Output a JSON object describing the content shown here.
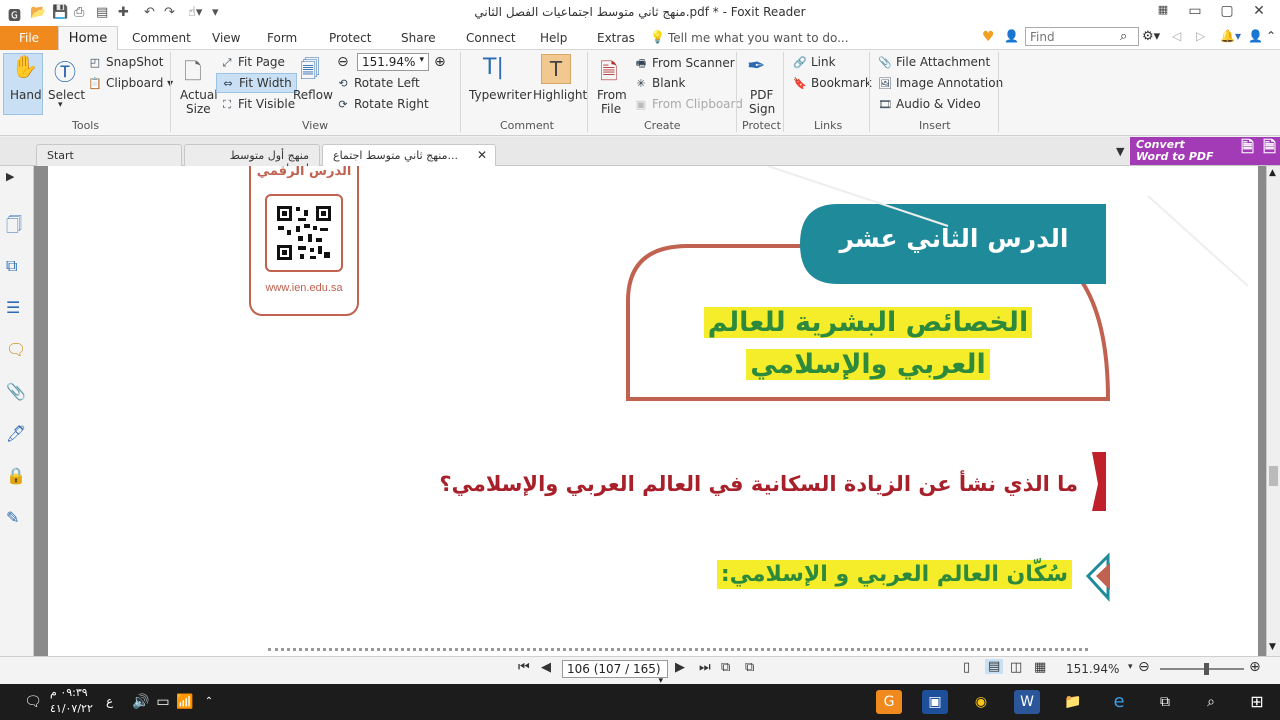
{
  "window": {
    "title": "منهج ثاني متوسط اجتماعيات الفصل الثاني.pdf * - Foxit Reader"
  },
  "menu": {
    "file": "File",
    "home": "Home",
    "items": [
      "Comment",
      "View",
      "Form",
      "Protect",
      "Share",
      "Connect",
      "Help",
      "Extras"
    ],
    "tellme": "Tell me what you want to do...",
    "find_placeholder": "Find"
  },
  "ribbon": {
    "tools": {
      "hand": "Hand",
      "select": "Select",
      "snapshot": "SnapShot",
      "clipboard": "Clipboard",
      "group": "Tools"
    },
    "view": {
      "actual": "Actual",
      "size": "Size",
      "fit_page": "Fit Page",
      "fit_width": "Fit Width",
      "fit_visible": "Fit Visible",
      "reflow": "Reflow",
      "zoom": "151.94%",
      "rotate_left": "Rotate Left",
      "rotate_right": "Rotate Right",
      "group": "View"
    },
    "comment": {
      "typewriter": "Typewriter",
      "highlight": "Highlight",
      "group": "Comment"
    },
    "create": {
      "from": "From",
      "file": "File",
      "from_scanner": "From Scanner",
      "blank": "Blank",
      "from_clipboard": "From Clipboard",
      "group": "Create"
    },
    "protect": {
      "pdf": "PDF",
      "sign": "Sign",
      "group": "Protect"
    },
    "links": {
      "link": "Link",
      "bookmark": "Bookmark",
      "group": "Links"
    },
    "insert": {
      "file_attachment": "File Attachment",
      "image_annotation": "Image Annotation",
      "audio_video": "Audio & Video",
      "group": "Insert"
    }
  },
  "tabs": [
    {
      "label": "Start"
    },
    {
      "label": "منهج أول متوسط اجتماع..."
    },
    {
      "label": "منهج ثاني متوسط اجتماع..."
    }
  ],
  "convert": {
    "line1": "Convert",
    "line2": "Word to PDF"
  },
  "page": {
    "digital_lesson": "الدرس الرقمي",
    "url": "www.ien.edu.sa",
    "lesson_number": "الدرس الثاني عشر",
    "title_line1": "الخصائص البشرية للعالم",
    "title_line2": "العربي والإسلامي",
    "question": "ما الذي نشأ عن الزيادة السكانية في العالم العربي والإسلامي؟",
    "section_heading": "سُكّان العالم العربي و الإسلامي:",
    "colors": {
      "teal": "#1f8a99",
      "frame": "#c0624f",
      "highlight": "#f5ec2a",
      "green_text": "#2d8a3c",
      "question_red": "#a8202a"
    }
  },
  "status": {
    "page": "106 (107 / 165)",
    "zoom": "151.94%"
  },
  "taskbar": {
    "time": "٠٩:٣٩ م",
    "date": "٤١/٠٧/٢٢",
    "lang": "ع"
  }
}
